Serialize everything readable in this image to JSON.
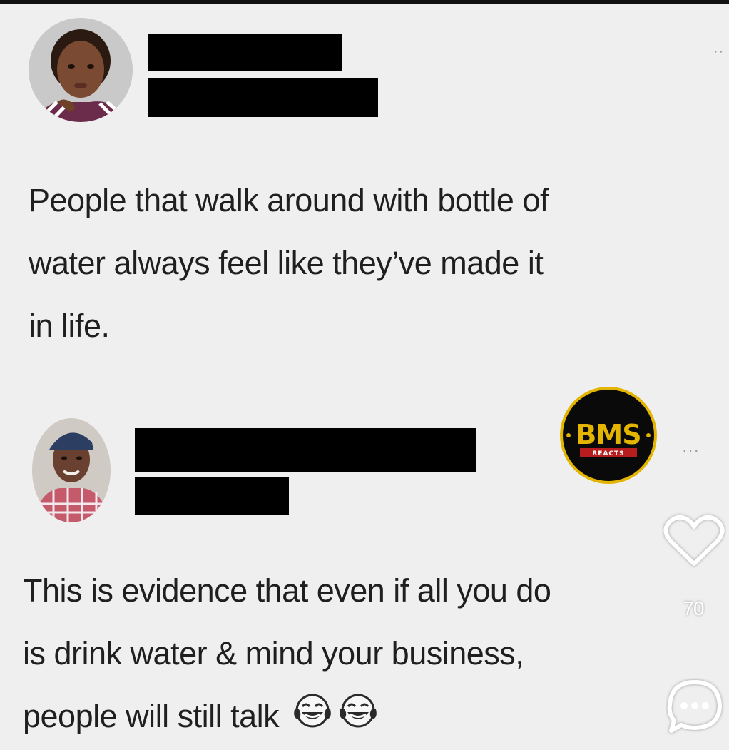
{
  "tweet1": {
    "avatar_icon": "woman-portrait-avatar",
    "text_lines": [
      "People that walk around with bottle of",
      "water always feel like they’ve made it",
      "in life."
    ],
    "more_icon": "ellipsis-icon"
  },
  "tweet2": {
    "avatar_icon": "man-portrait-avatar",
    "text_lines": [
      "This is evidence that even if all you do",
      "is drink water & mind your business,",
      "people will still talk"
    ],
    "emojis": [
      "face-with-tears-of-joy",
      "face-with-tears-of-joy"
    ],
    "more_icon": "ellipsis-icon"
  },
  "watermark": {
    "brand": "BMS",
    "tagline": "REACTS"
  },
  "overlay": {
    "like_icon": "heart-icon",
    "like_count": "70",
    "comment_icon": "comment-bubble-icon"
  },
  "colors": {
    "background": "#efefef",
    "text": "#1f1f1f",
    "redaction": "#000000",
    "logo_ring": "#e3b400"
  }
}
